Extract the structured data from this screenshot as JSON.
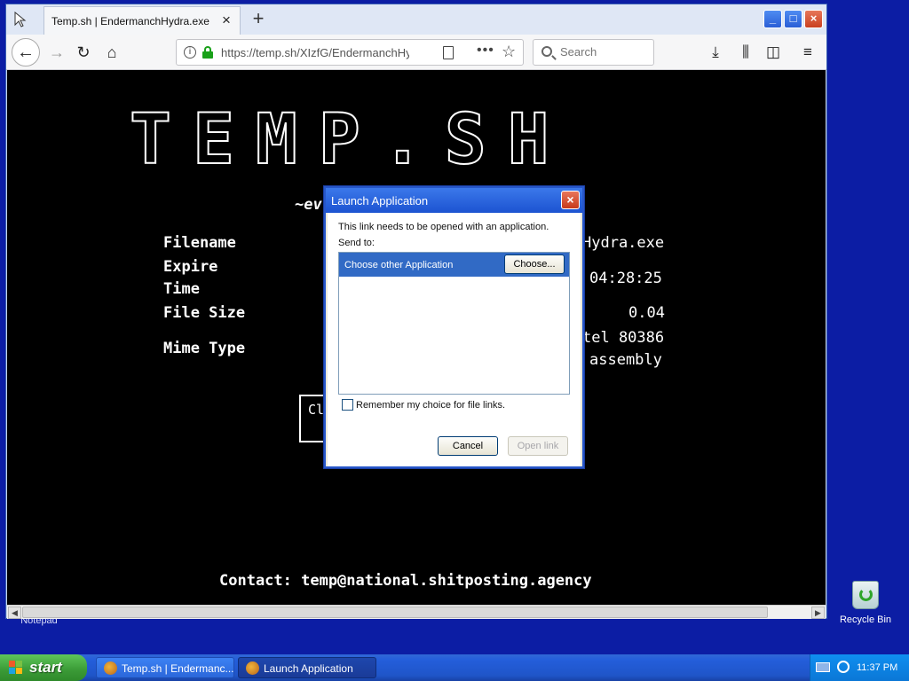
{
  "browser": {
    "tab_title": "Temp.sh | EndermanchHydra.exe",
    "tab_close": "×",
    "new_tab": "+",
    "url": "https://temp.sh/XIzfG/EndermanchHy",
    "search_placeholder": "Search",
    "window_buttons": {
      "minimize": "_",
      "maximize": "□",
      "close": "×"
    }
  },
  "page": {
    "logo": "TEMP.SH",
    "tagline": "~ev",
    "labels": {
      "filename": "Filename",
      "expire": "Expire",
      "time": "Time",
      "file_size": "File Size",
      "mime_type": "Mime Type"
    },
    "values": {
      "filename": "Hydra.exe",
      "expire_time": "04:28:25",
      "file_size": "0.04",
      "mime_line1": "tel 80386",
      "mime_line2": "assembly"
    },
    "click_box_text": "Cl",
    "contact": "Contact: temp@national.shitposting.agency"
  },
  "dialog": {
    "title": "Launch Application",
    "close": "×",
    "message": "This link needs to be opened with an application.",
    "send_to": "Send to:",
    "app_row": "Choose other Application",
    "choose_button": "Choose...",
    "remember": "Remember my choice for file links.",
    "cancel_button": "Cancel",
    "open_button": "Open link"
  },
  "desktop": {
    "recycle_bin": "Recycle Bin",
    "notepad": "Notepad"
  },
  "taskbar": {
    "start": "start",
    "tasks": [
      {
        "label": "Temp.sh | Endermanc..."
      },
      {
        "label": "Launch Application"
      }
    ],
    "clock": "11:37 PM"
  },
  "colors": {
    "desktop_bg": "#0c1da4",
    "dialog_title": "#1c53d1",
    "selection": "#316ac5",
    "start_green": "#3a9a36"
  }
}
